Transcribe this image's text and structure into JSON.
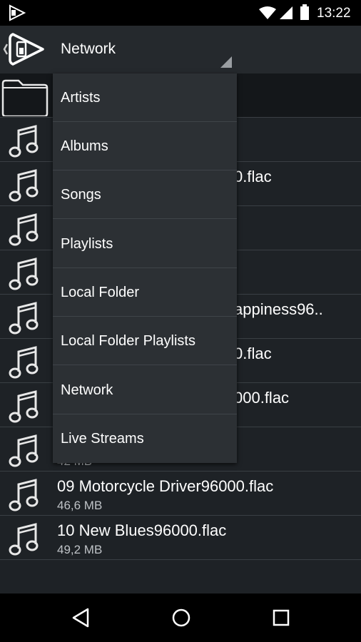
{
  "status_bar": {
    "time": "13:22"
  },
  "action_bar": {
    "title": "Network"
  },
  "dropdown": {
    "items": [
      {
        "label": "Artists"
      },
      {
        "label": "Albums"
      },
      {
        "label": "Songs"
      },
      {
        "label": "Playlists"
      },
      {
        "label": "Local Folder"
      },
      {
        "label": "Local Folder Playlists"
      },
      {
        "label": "Network"
      },
      {
        "label": "Live Streams"
      }
    ]
  },
  "files": [
    {
      "name": "",
      "size": ""
    },
    {
      "name": "",
      "size": ""
    },
    {
      "name": "0.flac",
      "size": ""
    },
    {
      "name": "",
      "size": ""
    },
    {
      "name": "",
      "size": ""
    },
    {
      "name": "appiness96..",
      "size": ""
    },
    {
      "name": "0.flac",
      "size": ""
    },
    {
      "name": "000.flac",
      "size": ""
    },
    {
      "name": "",
      "size": "42 MB"
    },
    {
      "name": "09 Motorcycle Driver96000.flac",
      "size": "46,6 MB"
    },
    {
      "name": "10 New Blues96000.flac",
      "size": "49,2 MB"
    }
  ],
  "icons": {
    "folder": "folder-icon",
    "music": "music-note-icon",
    "back": "back-triangle-icon",
    "home": "home-circle-icon",
    "recents": "recents-square-icon"
  }
}
